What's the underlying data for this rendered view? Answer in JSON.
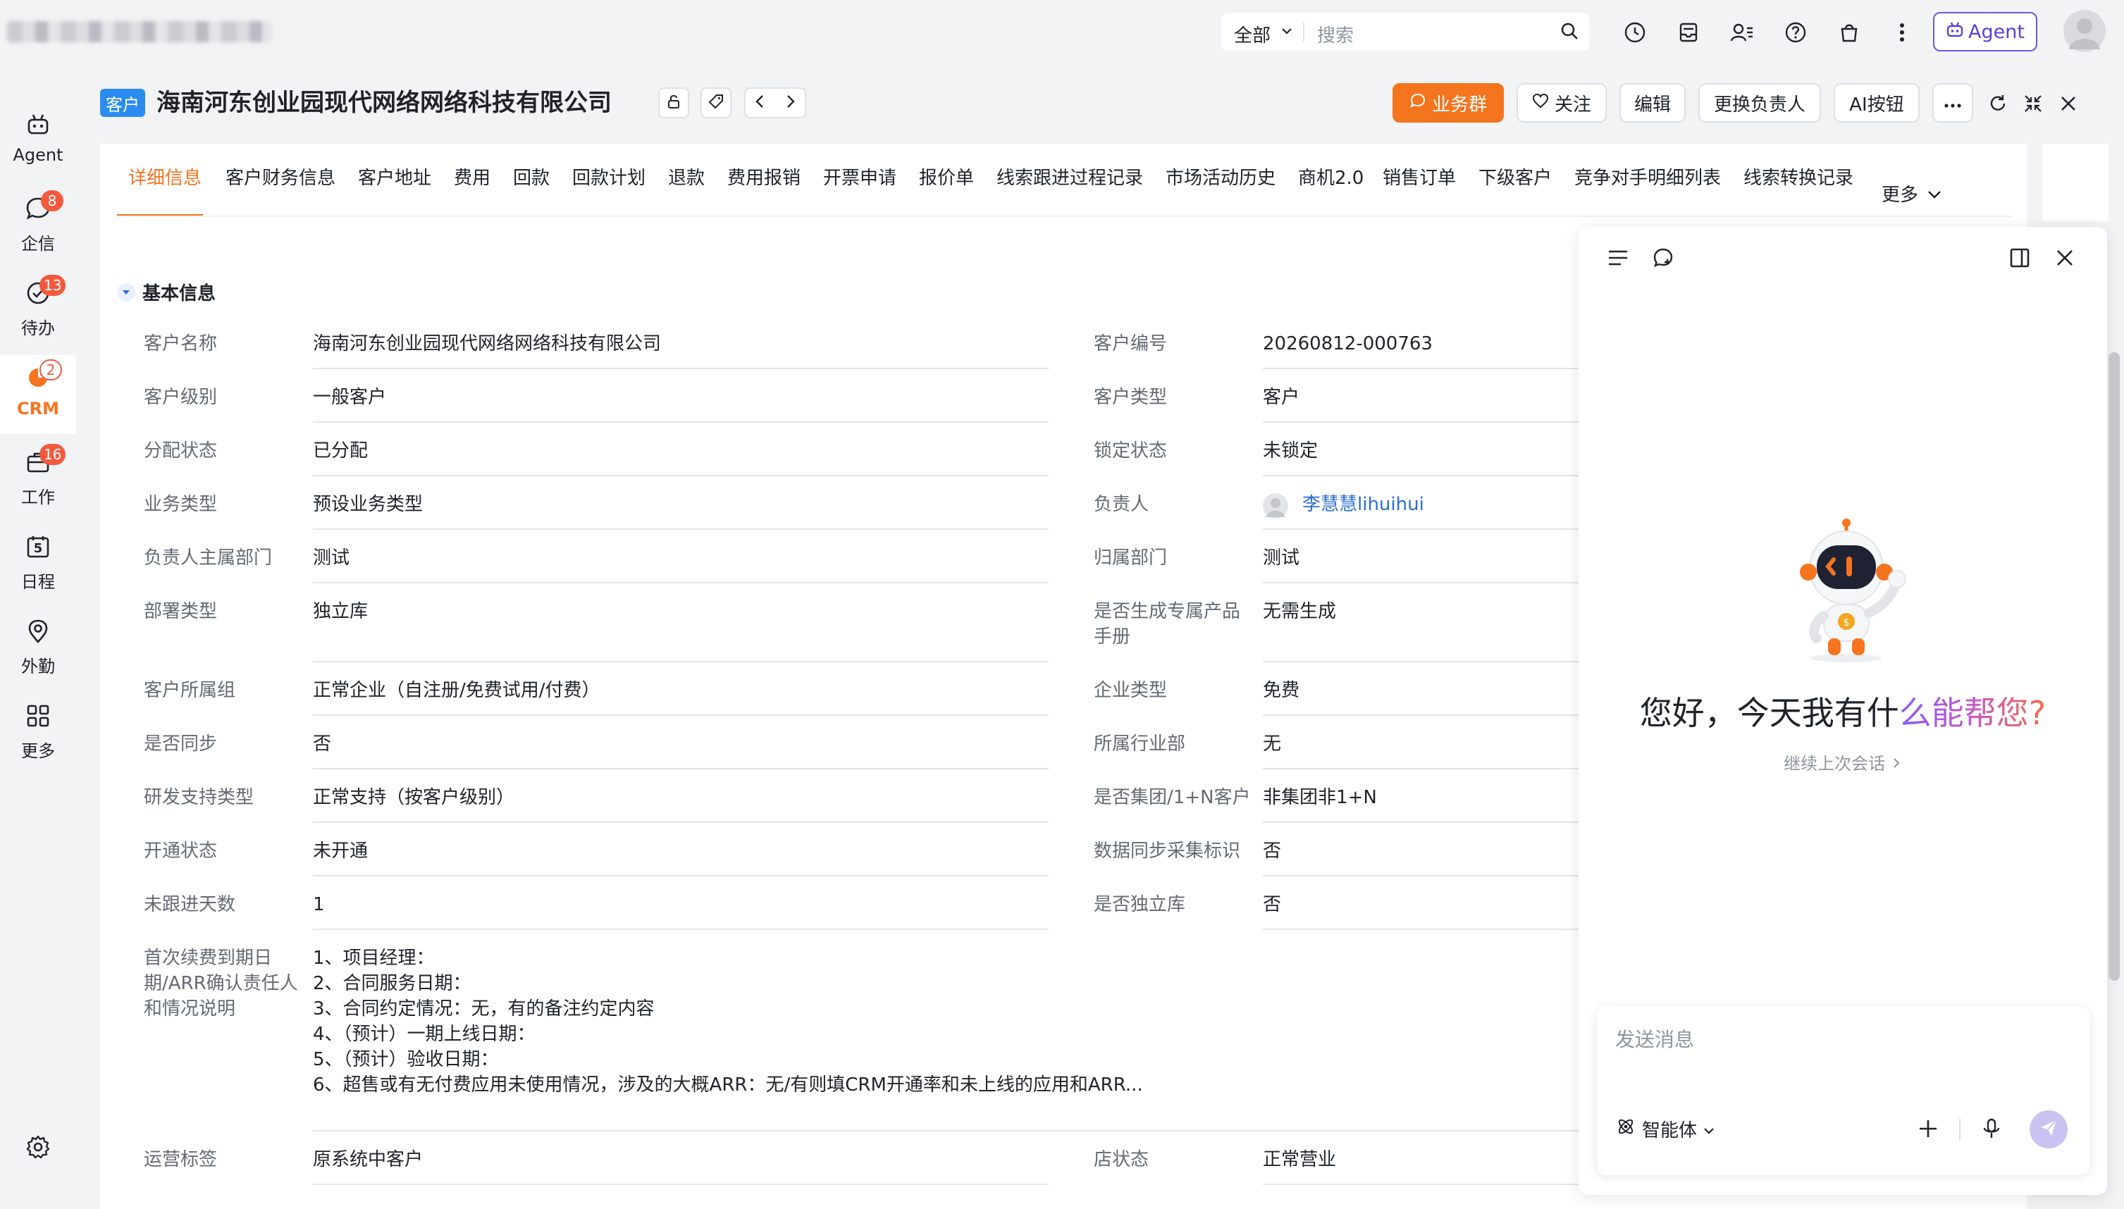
{
  "topbar": {
    "search_scope": "全部",
    "search_placeholder": "搜索",
    "agent_label": "Agent"
  },
  "sidenav": {
    "items": [
      {
        "label": "Agent",
        "icon": "robot-icon",
        "badge": ""
      },
      {
        "label": "企信",
        "icon": "chat-icon",
        "badge": "8"
      },
      {
        "label": "待办",
        "icon": "check-circle-icon",
        "badge": "13"
      },
      {
        "label": "CRM",
        "icon": "crm-pie-icon",
        "badge": "2"
      },
      {
        "label": "工作",
        "icon": "briefcase-icon",
        "badge": "16"
      },
      {
        "label": "日程",
        "icon": "calendar-icon",
        "badge": "",
        "day": "5"
      },
      {
        "label": "外勤",
        "icon": "location-pin-icon",
        "badge": ""
      },
      {
        "label": "更多",
        "icon": "grid-icon",
        "badge": ""
      }
    ]
  },
  "header": {
    "object_tag": "客户",
    "title": "海南河东创业园现代网络网络科技有限公司",
    "buttons": {
      "group": "业务群",
      "follow": "关注",
      "edit": "编辑",
      "change_owner": "更换负责人",
      "ai": "AI按钮"
    }
  },
  "tabs": {
    "items": [
      "详细信息",
      "客户财务信息",
      "客户地址",
      "费用",
      "回款",
      "回款计划",
      "退款",
      "费用报销",
      "开票申请",
      "报价单",
      "线索跟进过程记录",
      "市场活动历史",
      "商机2.0",
      "销售订单",
      "下级客户",
      "竞争对手明细列表",
      "线索转换记录"
    ],
    "more": "更多"
  },
  "section": {
    "title": "基本信息",
    "left": [
      {
        "label": "客户名称",
        "value": "海南河东创业园现代网络网络科技有限公司"
      },
      {
        "label": "客户级别",
        "value": "一般客户"
      },
      {
        "label": "分配状态",
        "value": "已分配"
      },
      {
        "label": "业务类型",
        "value": "预设业务类型"
      },
      {
        "label": "负责人主属部门",
        "value": "测试"
      },
      {
        "label": "部署类型",
        "value": "独立库"
      },
      {
        "label": "客户所属组",
        "value": "正常企业（自注册/免费试用/付费）"
      },
      {
        "label": "是否同步",
        "value": "否"
      },
      {
        "label": "研发支持类型",
        "value": "正常支持（按客户级别）"
      },
      {
        "label": "开通状态",
        "value": "未开通"
      },
      {
        "label": "未跟进天数",
        "value": "1"
      }
    ],
    "right": [
      {
        "label": "客户编号",
        "value": "20260812-000763"
      },
      {
        "label": "客户类型",
        "value": "客户"
      },
      {
        "label": "锁定状态",
        "value": "未锁定"
      },
      {
        "label": "负责人",
        "value": "李慧慧lihuihui"
      },
      {
        "label": "归属部门",
        "value": "测试"
      },
      {
        "label": "是否生成专属产品手册",
        "value": "无需生成"
      },
      {
        "label": "企业类型",
        "value": "免费"
      },
      {
        "label": "所属行业部",
        "value": "无"
      },
      {
        "label": "是否集团/1+N客户",
        "value": "非集团非1+N"
      },
      {
        "label": "数据同步采集标识",
        "value": "否"
      },
      {
        "label": "是否独立库",
        "value": "否"
      }
    ],
    "arr": {
      "label": "首次续费到期日期/ARR确认责任人和情况说明",
      "lines": [
        "1、项目经理：",
        "2、合同服务日期：",
        "3、合同约定情况：无，有的备注约定内容",
        "4、（预计）一期上线日期：",
        "5、（预计）验收日期：",
        "6、超售或有无付费应用未使用情况，涉及的大概ARR：无/有则填CRM开通率和未上线的应用和ARR..."
      ]
    },
    "ops_tag": {
      "label": "运营标签",
      "value": "原系统中客户"
    },
    "store_status": {
      "label": "店状态",
      "value": "正常营业"
    }
  },
  "ai_panel": {
    "greeting_plain": "您好，今天我有什",
    "greeting_colored": "么能帮您?",
    "continue_label": "继续上次会话",
    "input_placeholder": "发送消息",
    "mode_label": "智能体",
    "accent_color": "#8a5cf6"
  },
  "colors": {
    "brand_orange": "#f5741e",
    "tag_blue": "#2b8cf0",
    "badge_red": "#f4593d",
    "link_blue": "#2b6fd6"
  }
}
